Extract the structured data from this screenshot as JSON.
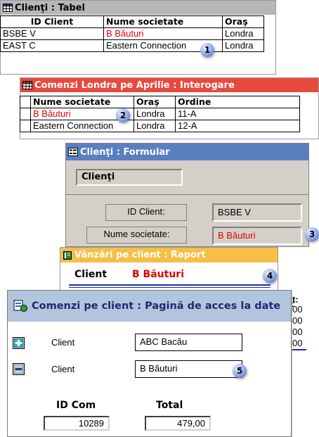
{
  "table_window": {
    "title": "Clienţi : Tabel",
    "columns": [
      "ID Client",
      "Nume societate",
      "Oraş"
    ],
    "rows": [
      [
        "BSBE V",
        "B Băuturi",
        "Londra"
      ],
      [
        "EAST C",
        "Eastern Connection",
        "Londra"
      ]
    ]
  },
  "query_window": {
    "title": "Comenzi Londra pe Aprilie : Interogare",
    "columns": [
      "Nume societate",
      "Oraş",
      "Ordine"
    ],
    "rows": [
      [
        "B Băuturi",
        "Londra",
        "11-A"
      ],
      [
        "Eastern Connection",
        "Londra",
        "12-A"
      ]
    ]
  },
  "form_window": {
    "title": "Clienţi : Formular",
    "header": "Clienţi",
    "id_label": "ID Client:",
    "id_value": "BSBE V",
    "name_label": "Nume societate:",
    "name_value": "B Băuturi"
  },
  "report_window": {
    "title": "Vânzări pe client : Raport",
    "client_label": "Client",
    "client_value": "B Băuturi",
    "partial_header": "t:",
    "partial_values": [
      "00",
      "00",
      "00",
      "00"
    ]
  },
  "page_window": {
    "title": "Comenzi pe client : Pagină de acces la date",
    "client_label_1": "Client",
    "client_value_1": "ABC Bacău",
    "client_label_2": "Client",
    "client_value_2": "B Băuturi",
    "col1_header": "ID Com",
    "col2_header": "Total",
    "col1_value": "10289",
    "col2_value": "479,00"
  },
  "callouts": [
    "1",
    "2",
    "3",
    "4",
    "5"
  ],
  "colors": {
    "table_title_bg": "#b7b7b7",
    "query_title_bg": "#e8493f",
    "form_title_bg": "#5a7fc0",
    "report_title_bg": "#f5bf45",
    "page_title_bg": "#b3c4df",
    "accent_red": "#e00000",
    "report_line": "#1a2db8"
  }
}
